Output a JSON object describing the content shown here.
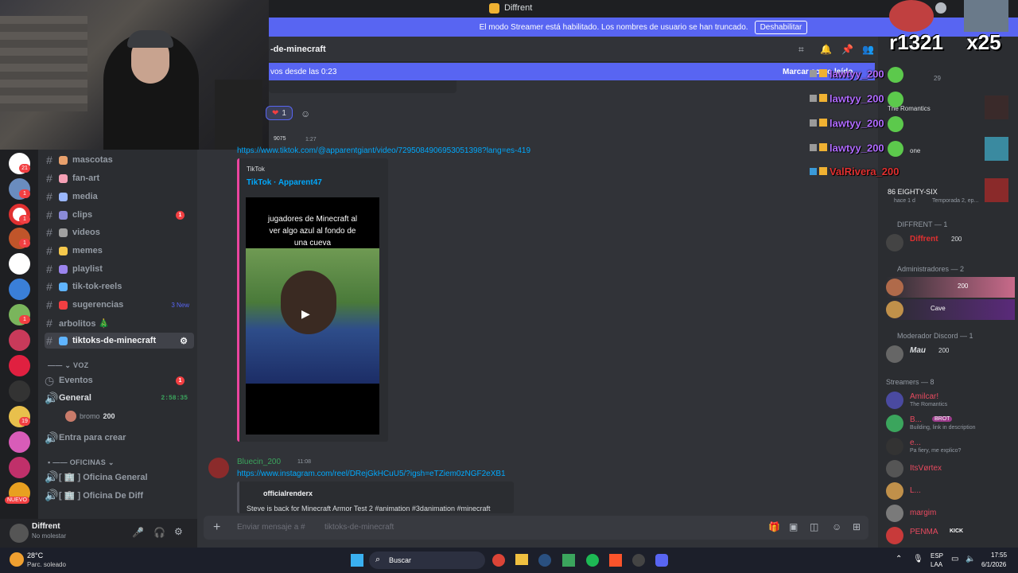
{
  "window": {
    "title": "Diffrent"
  },
  "streamer_banner": {
    "text": "El modo Streamer está habilitado. Los nombres de usuario se han truncado.",
    "button": "Deshabilitar"
  },
  "server_badges": [
    "21",
    "1",
    "1",
    "1",
    "1",
    "1",
    "19"
  ],
  "nuevo_badge": "NUEVO",
  "channels": [
    {
      "name": "mascotas",
      "color": "#e8a06c"
    },
    {
      "name": "fan-art",
      "color": "#f5a0b5"
    },
    {
      "name": "media",
      "color": "#9ab7ff"
    },
    {
      "name": "clips",
      "color": "#8b8bd8",
      "badge": "1"
    },
    {
      "name": "videos",
      "color": "#a0a0a0"
    },
    {
      "name": "memes",
      "color": "#f5c84c"
    },
    {
      "name": "playlist",
      "color": "#9b84ee"
    },
    {
      "name": "tik-tok-reels",
      "color": "#5fb4ff"
    },
    {
      "name": "sugerencias",
      "color": "#f23f42",
      "badge": "3 New"
    },
    {
      "name": "arbolitos 🎄",
      "color": "#3ba55d"
    },
    {
      "name": "tiktoks-de-minecraft",
      "color": "#5fb4ff",
      "selected": true
    }
  ],
  "voice_category": "VOZ",
  "events": {
    "label": "Eventos",
    "badge": "1"
  },
  "voice_general": {
    "label": "General",
    "time": "2:58:35",
    "user": "bromo",
    "user_tag": "200"
  },
  "enter_to_create": "Entra para crear",
  "oficinas_category": "OFICINAS",
  "oficinas": [
    "[ 🏢 ] Oficina General",
    "[ 🏢 ] Oficina De Diff"
  ],
  "user": {
    "name": "Diffrent",
    "status": "No molestar"
  },
  "chat_header": {
    "channel": "-de-minecraft"
  },
  "new_messages": {
    "text": "vos desde las 0:23",
    "mark": "Marcar como leído"
  },
  "reaction": {
    "emoji": "❤",
    "count": "1"
  },
  "message1": {
    "tag": "9075",
    "time": "1:27",
    "link": "https://www.tiktok.com/@apparentgiant/video/7295084906953051398?lang=es-419",
    "embed_site": "TikTok",
    "embed_title": "TikTok · Apparent47",
    "video_caption": "jugadores de Minecraft al ver algo azul al fondo de una cueva"
  },
  "message2": {
    "author": "Bluecin_200",
    "time": "11:08",
    "link": "https://www.instagram.com/reel/DRejGkHCuU5/?igsh=eTZiem0zNGF2eXB1",
    "embed_author": "officialrenderx",
    "embed_text": "Steve is back for Minecraft Armor Test 2 #animation #3danimation #minecraft"
  },
  "input_placeholder": "Enviar mensaje a #",
  "input_channel": "tiktoks-de-minecraft",
  "chat_overlay": {
    "top_names": [
      "r1321",
      "x25"
    ],
    "lines": [
      "lawtyy_200",
      "lawtyy_200",
      "lawtyy_200",
      "lawtyy_200",
      "ValRivera_200"
    ],
    "last_color": "#e03030"
  },
  "members": {
    "header_count": "29",
    "activity_top": [
      "The Romantics",
      "one",
      "86 EIGHTY-SIX",
      "hace 1 d",
      "Temporada 2, ep..."
    ],
    "groups": [
      {
        "title": "DIFFRENT — 1",
        "members": [
          {
            "name": "Diffrent",
            "tag": "200",
            "color": "#e03030"
          }
        ]
      },
      {
        "title": "Administradores — 2",
        "members": [
          {
            "name": "",
            "tag": "200",
            "color": "#5865f2"
          },
          {
            "name": "",
            "tag": "Cave",
            "color": "#5865f2"
          }
        ]
      },
      {
        "title": "Moderador Discord — 1",
        "members": [
          {
            "name": "Mau",
            "tag": "200",
            "color": "#dbdee1"
          }
        ]
      },
      {
        "title": "Streamers — 8",
        "members": [
          {
            "name": "Amilcar!",
            "status": "The Romantics",
            "color": "#e84a5f"
          },
          {
            "name": "B...",
            "tag": "BROT",
            "status": "Building, link in description",
            "color": "#e84a5f"
          },
          {
            "name": "e...",
            "status": "Pa fiery, me explico?",
            "color": "#e84a5f"
          },
          {
            "name": "ItsVørtex",
            "color": "#e84a5f"
          },
          {
            "name": "L...",
            "color": "#e84a5f"
          },
          {
            "name": "margim",
            "color": "#e84a5f"
          },
          {
            "name": "PENMA",
            "tag": "KICK",
            "color": "#e84a5f"
          }
        ]
      }
    ]
  },
  "taskbar": {
    "weather_temp": "28°C",
    "weather_desc": "Parc. soleado",
    "search": "Buscar",
    "lang": "ESP",
    "lang2": "LAA",
    "time": "17:55",
    "date": "6/1/2026"
  }
}
